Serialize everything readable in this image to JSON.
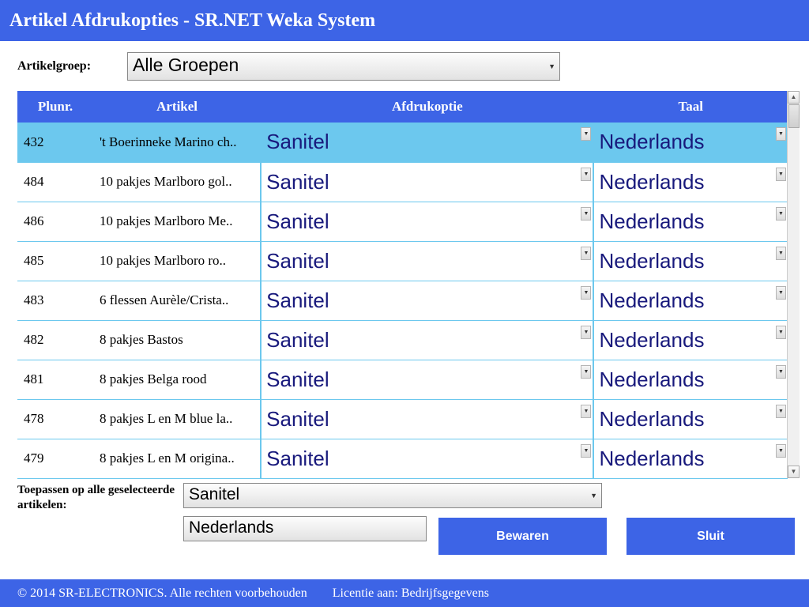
{
  "header": {
    "title": "Artikel Afdrukopties - SR.NET Weka System"
  },
  "filter": {
    "label": "Artikelgroep:",
    "value": "Alle Groepen"
  },
  "table": {
    "columns": {
      "plunr": "Plunr.",
      "artikel": "Artikel",
      "afdrukoptie": "Afdrukoptie",
      "taal": "Taal"
    },
    "rows": [
      {
        "plunr": "432",
        "artikel": "'t Boerinneke Marino ch..",
        "afdrukoptie": "Sanitel",
        "taal": "Nederlands",
        "selected": true
      },
      {
        "plunr": "484",
        "artikel": "10 pakjes Marlboro gol..",
        "afdrukoptie": "Sanitel",
        "taal": "Nederlands",
        "selected": false
      },
      {
        "plunr": "486",
        "artikel": "10 pakjes Marlboro Me..",
        "afdrukoptie": "Sanitel",
        "taal": "Nederlands",
        "selected": false
      },
      {
        "plunr": "485",
        "artikel": "10 pakjes Marlboro ro..",
        "afdrukoptie": "Sanitel",
        "taal": "Nederlands",
        "selected": false
      },
      {
        "plunr": "483",
        "artikel": "6 flessen Aurèle/Crista..",
        "afdrukoptie": "Sanitel",
        "taal": "Nederlands",
        "selected": false
      },
      {
        "plunr": "482",
        "artikel": "8 pakjes Bastos",
        "afdrukoptie": "Sanitel",
        "taal": "Nederlands",
        "selected": false
      },
      {
        "plunr": "481",
        "artikel": "8 pakjes Belga rood",
        "afdrukoptie": "Sanitel",
        "taal": "Nederlands",
        "selected": false
      },
      {
        "plunr": "478",
        "artikel": "8 pakjes L en M blue la..",
        "afdrukoptie": "Sanitel",
        "taal": "Nederlands",
        "selected": false
      },
      {
        "plunr": "479",
        "artikel": "8 pakjes L en M origina..",
        "afdrukoptie": "Sanitel",
        "taal": "Nederlands",
        "selected": false
      }
    ]
  },
  "apply": {
    "label": "Toepassen op alle geselecteerde artikelen:",
    "afdrukoptie": "Sanitel",
    "taal": "Nederlands"
  },
  "buttons": {
    "save": "Bewaren",
    "close": "Sluit"
  },
  "footer": {
    "copyright": "© 2014 SR-ELECTRONICS. Alle rechten voorbehouden",
    "license": "Licentie aan: Bedrijfsgegevens"
  }
}
